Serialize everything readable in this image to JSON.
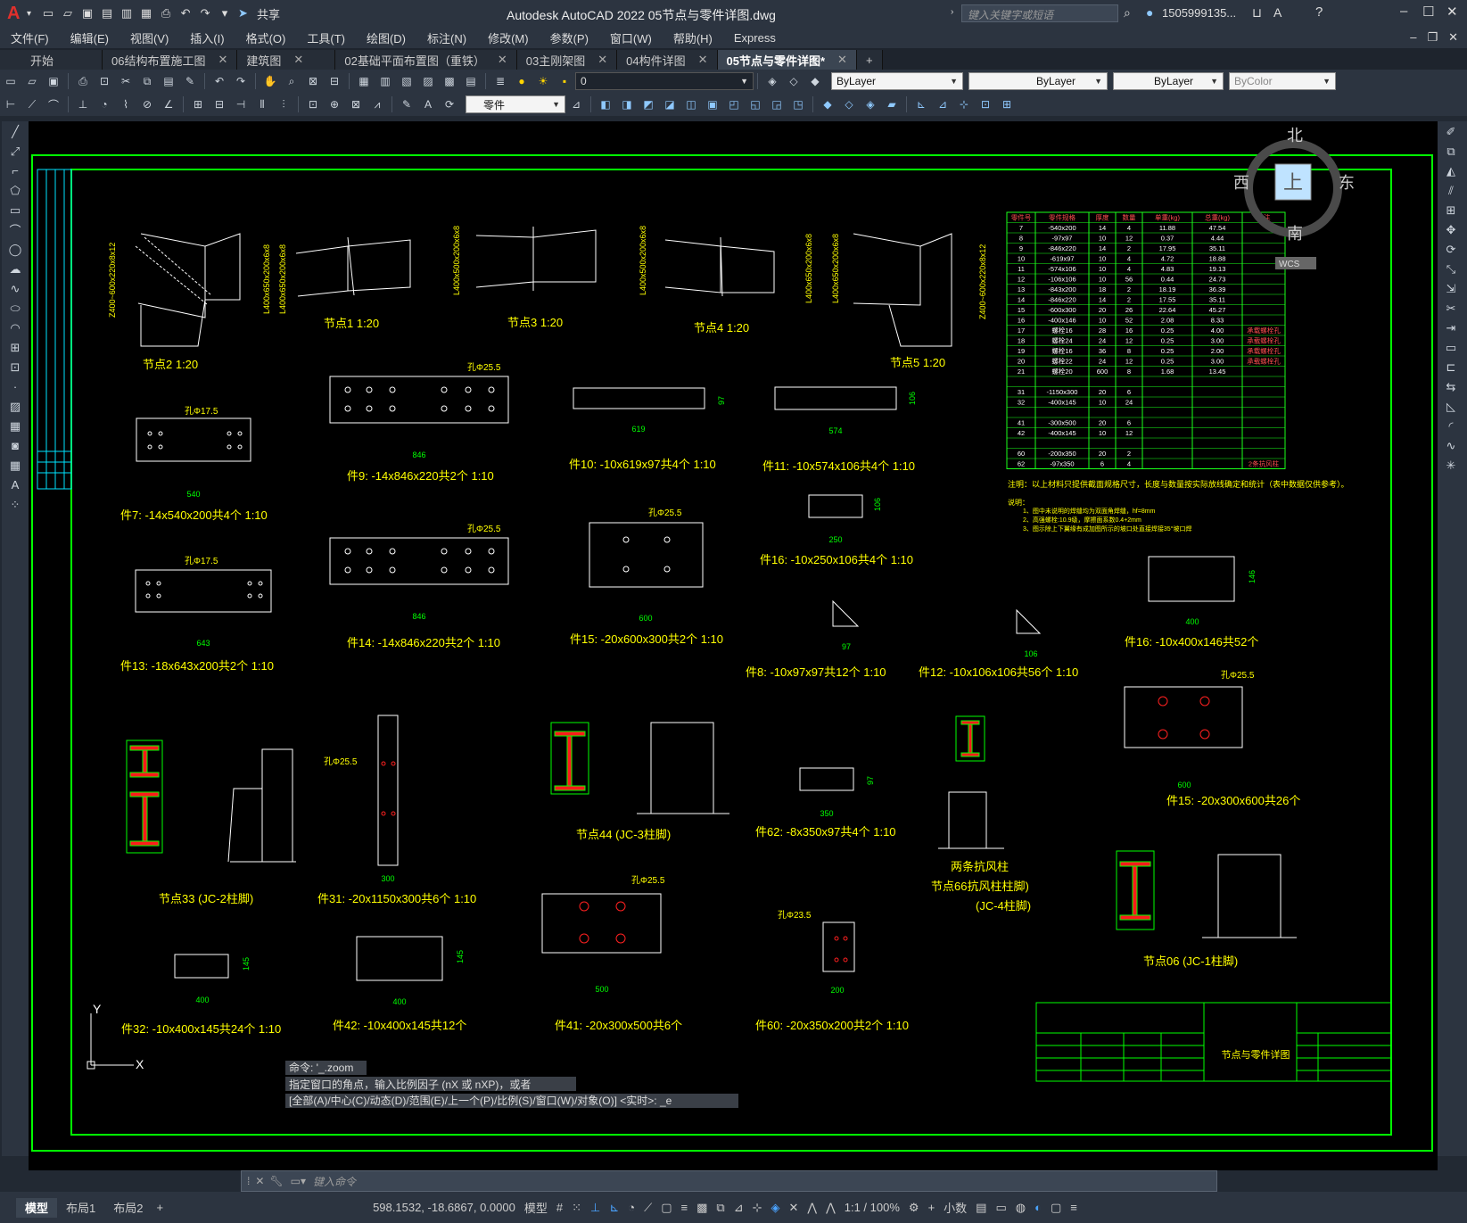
{
  "app": {
    "title": "Autodesk AutoCAD 2022    05节点与零件详图.dwg",
    "share": "共享",
    "search_placeholder": "键入关键字或短语",
    "user": "1505999135...",
    "colors": {
      "brand": "#e0302c",
      "drawing_green": "#00ff00",
      "text_yellow": "#ffff00",
      "accent_red": "#ff0000",
      "table_green": "#1aff1a",
      "viewcube_blue": "#bfe3ff"
    }
  },
  "menu": [
    "文件(F)",
    "编辑(E)",
    "视图(V)",
    "插入(I)",
    "格式(O)",
    "工具(T)",
    "绘图(D)",
    "标注(N)",
    "修改(M)",
    "参数(P)",
    "窗口(W)",
    "帮助(H)",
    "Express"
  ],
  "tabs": [
    {
      "label": "开始",
      "active": false
    },
    {
      "label": "06结构布置施工图",
      "active": false
    },
    {
      "label": "建筑图",
      "active": false
    },
    {
      "label": "02基础平面布置图（重铁）",
      "active": false
    },
    {
      "label": "03主刚架图",
      "active": false
    },
    {
      "label": "04构件详图",
      "active": false
    },
    {
      "label": "05节点与零件详图*",
      "active": true
    }
  ],
  "layer_combo": "0",
  "color_combo": "ByLayer",
  "linetype_combo": "ByLayer",
  "lineweight_combo": "ByLayer",
  "plotstyle_combo": "ByColor",
  "style_combo": "零件",
  "viewcube": {
    "n": "北",
    "s": "南",
    "e": "东",
    "w": "西",
    "top": "上",
    "wcs": "WCS"
  },
  "drawing": {
    "nodes": [
      {
        "label": "节点2 1:20"
      },
      {
        "label": "节点1 1:20"
      },
      {
        "label": "节点3 1:20"
      },
      {
        "label": "节点4 1:20"
      },
      {
        "label": "节点5 1:20"
      }
    ],
    "vlabels": [
      "Z400~600x220x8x12",
      "L400x650x200x6x8",
      "L400x650x200x6x8",
      "L400x500x200x6x8",
      "L400x500x200x6x8",
      "L400x650x200x6x8",
      "L400x650x200x6x8",
      "Z400~600x220x8x12"
    ],
    "parts": [
      {
        "label": "件7:  -14x540x200共4个  1:10",
        "hole": "孔Φ17.5",
        "dim": "540"
      },
      {
        "label": "件9:  -14x846x220共2个  1:10",
        "hole": "孔Φ25.5",
        "dim": "846"
      },
      {
        "label": "件10:  -10x619x97共4个  1:10",
        "dim": "619",
        "vdim": "97"
      },
      {
        "label": "件11:  -10x574x106共4个  1:10",
        "dim": "574",
        "vdim": "106"
      },
      {
        "label": "件13:  -18x643x200共2个  1:10",
        "hole": "孔Φ17.5",
        "dim": "643"
      },
      {
        "label": "件14:  -14x846x220共2个  1:10",
        "hole": "孔Φ25.5",
        "dim": "846"
      },
      {
        "label": "件15:  -20x600x300共2个  1:10",
        "hole": "孔Φ25.5",
        "dim": "600"
      },
      {
        "label": "件16:  -10x250x106共4个  1:10",
        "dim": "250",
        "vdim": "106"
      },
      {
        "label": "件8:  -10x97x97共12个  1:10",
        "dim": "97"
      },
      {
        "label": "件12:  -10x106x106共56个  1:10",
        "dim": "106"
      },
      {
        "label": "件16:  -10x400x146共52个",
        "dim": "400",
        "vdim": "146"
      },
      {
        "label": "件15:  -20x300x600共26个",
        "hole": "孔Φ25.5",
        "dim": "600"
      },
      {
        "label": "件31:  -20x1150x300共6个  1:10",
        "hole": "孔Φ25.5",
        "dim": "300"
      },
      {
        "label": "件62:  -8x350x97共4个  1:10",
        "dim": "350",
        "vdim": "97"
      },
      {
        "label": "件32:  -10x400x145共24个  1:10",
        "dim": "400",
        "vdim": "145"
      },
      {
        "label": "件42:  -10x400x145共12个",
        "dim": "400",
        "vdim": "145"
      },
      {
        "label": "件41:  -20x300x500共6个",
        "hole": "孔Φ25.5",
        "dim": "500"
      },
      {
        "label": "件60:  -20x350x200共2个  1:10",
        "hole": "孔Φ23.5",
        "dim": "200"
      }
    ],
    "details": [
      {
        "label": "节点33 (JC-2柱脚)"
      },
      {
        "label": "节点44 (JC-3柱脚)"
      },
      {
        "label": "两条抗风柱"
      },
      {
        "label": "节点66抗风柱柱脚)"
      },
      {
        "label": "(JC-4柱脚)"
      },
      {
        "label": "节点06 (JC-1柱脚)"
      }
    ],
    "table_header": [
      "零件号",
      "零件规格",
      "厚度",
      "数量",
      "单重(kg)",
      "总重(kg)",
      "备注"
    ],
    "table_rows": [
      [
        "7",
        "-540x200",
        "14",
        "4",
        "11.88",
        "47.54",
        ""
      ],
      [
        "8",
        "-97x97",
        "10",
        "12",
        "0.37",
        "4.44",
        ""
      ],
      [
        "9",
        "-846x220",
        "14",
        "2",
        "17.95",
        "35.11",
        ""
      ],
      [
        "10",
        "-619x97",
        "10",
        "4",
        "4.72",
        "18.88",
        ""
      ],
      [
        "11",
        "-574x106",
        "10",
        "4",
        "4.83",
        "19.13",
        ""
      ],
      [
        "12",
        "-106x106",
        "10",
        "56",
        "0.44",
        "24.73",
        ""
      ],
      [
        "13",
        "-843x200",
        "18",
        "2",
        "18.19",
        "36.39",
        ""
      ],
      [
        "14",
        "-846x220",
        "14",
        "2",
        "17.55",
        "35.11",
        ""
      ],
      [
        "15",
        "-600x300",
        "20",
        "26",
        "22.64",
        "45.27",
        ""
      ],
      [
        "16",
        "-400x146",
        "10",
        "52",
        "2.08",
        "8.33",
        ""
      ],
      [
        "17",
        "螺栓16",
        "28",
        "16",
        "0.25",
        "4.00",
        "承载螺栓孔"
      ],
      [
        "18",
        "螺栓24",
        "24",
        "12",
        "0.25",
        "3.00",
        "承载螺栓孔"
      ],
      [
        "19",
        "螺栓16",
        "36",
        "8",
        "0.25",
        "2.00",
        "承载螺栓孔"
      ],
      [
        "20",
        "螺栓22",
        "24",
        "12",
        "0.25",
        "3.00",
        "承载螺栓孔"
      ],
      [
        "21",
        "螺栓20",
        "600",
        "8",
        "1.68",
        "13.45",
        ""
      ],
      [
        "",
        "",
        "",
        "",
        "",
        "",
        ""
      ],
      [
        "31",
        "-1150x300",
        "20",
        "6",
        "",
        "",
        ""
      ],
      [
        "32",
        "-400x145",
        "10",
        "24",
        "",
        "",
        ""
      ],
      [
        "",
        "",
        "",
        "",
        "",
        "",
        ""
      ],
      [
        "41",
        "-300x500",
        "20",
        "6",
        "",
        "",
        ""
      ],
      [
        "42",
        "-400x145",
        "10",
        "12",
        "",
        "",
        ""
      ],
      [
        "",
        "",
        "",
        "",
        "",
        "",
        ""
      ],
      [
        "60",
        "-200x350",
        "20",
        "2",
        "",
        "",
        ""
      ],
      [
        "62",
        "-97x350",
        "6",
        "4",
        "",
        "",
        "2条抗风柱"
      ]
    ],
    "notes": [
      "注明：以上材料只提供截面规格尺寸，长度与数量按实际放线确定和统计（表中数据仅供参考）。",
      "说明：",
      "1、图中未说明的焊缝均为双面角焊缝，hf=8mm",
      "2、高强螺栓:10.9级，摩擦面系数0.4+2mm",
      "3、图示除上下翼缘有成加图所示的坡口处直接焊接35°坡口焊"
    ],
    "title_block": {
      "title": "节点与零件详图"
    }
  },
  "command": {
    "history": [
      "命令: '_.zoom",
      "指定窗口的角点，输入比例因子 (nX 或 nXP)，或者",
      "[全部(A)/中心(C)/动态(D)/范围(E)/上一个(P)/比例(S)/窗口(W)/对象(O)] <实时>: _e"
    ],
    "placeholder": "键入命令"
  },
  "status": {
    "layouts": [
      {
        "label": "模型",
        "active": true
      },
      {
        "label": "布局1",
        "active": false
      },
      {
        "label": "布局2",
        "active": false
      }
    ],
    "coords": "598.1532, -18.6867, 0.0000",
    "mode": "模型",
    "scale": "1:1 / 100%",
    "units": "小数"
  }
}
